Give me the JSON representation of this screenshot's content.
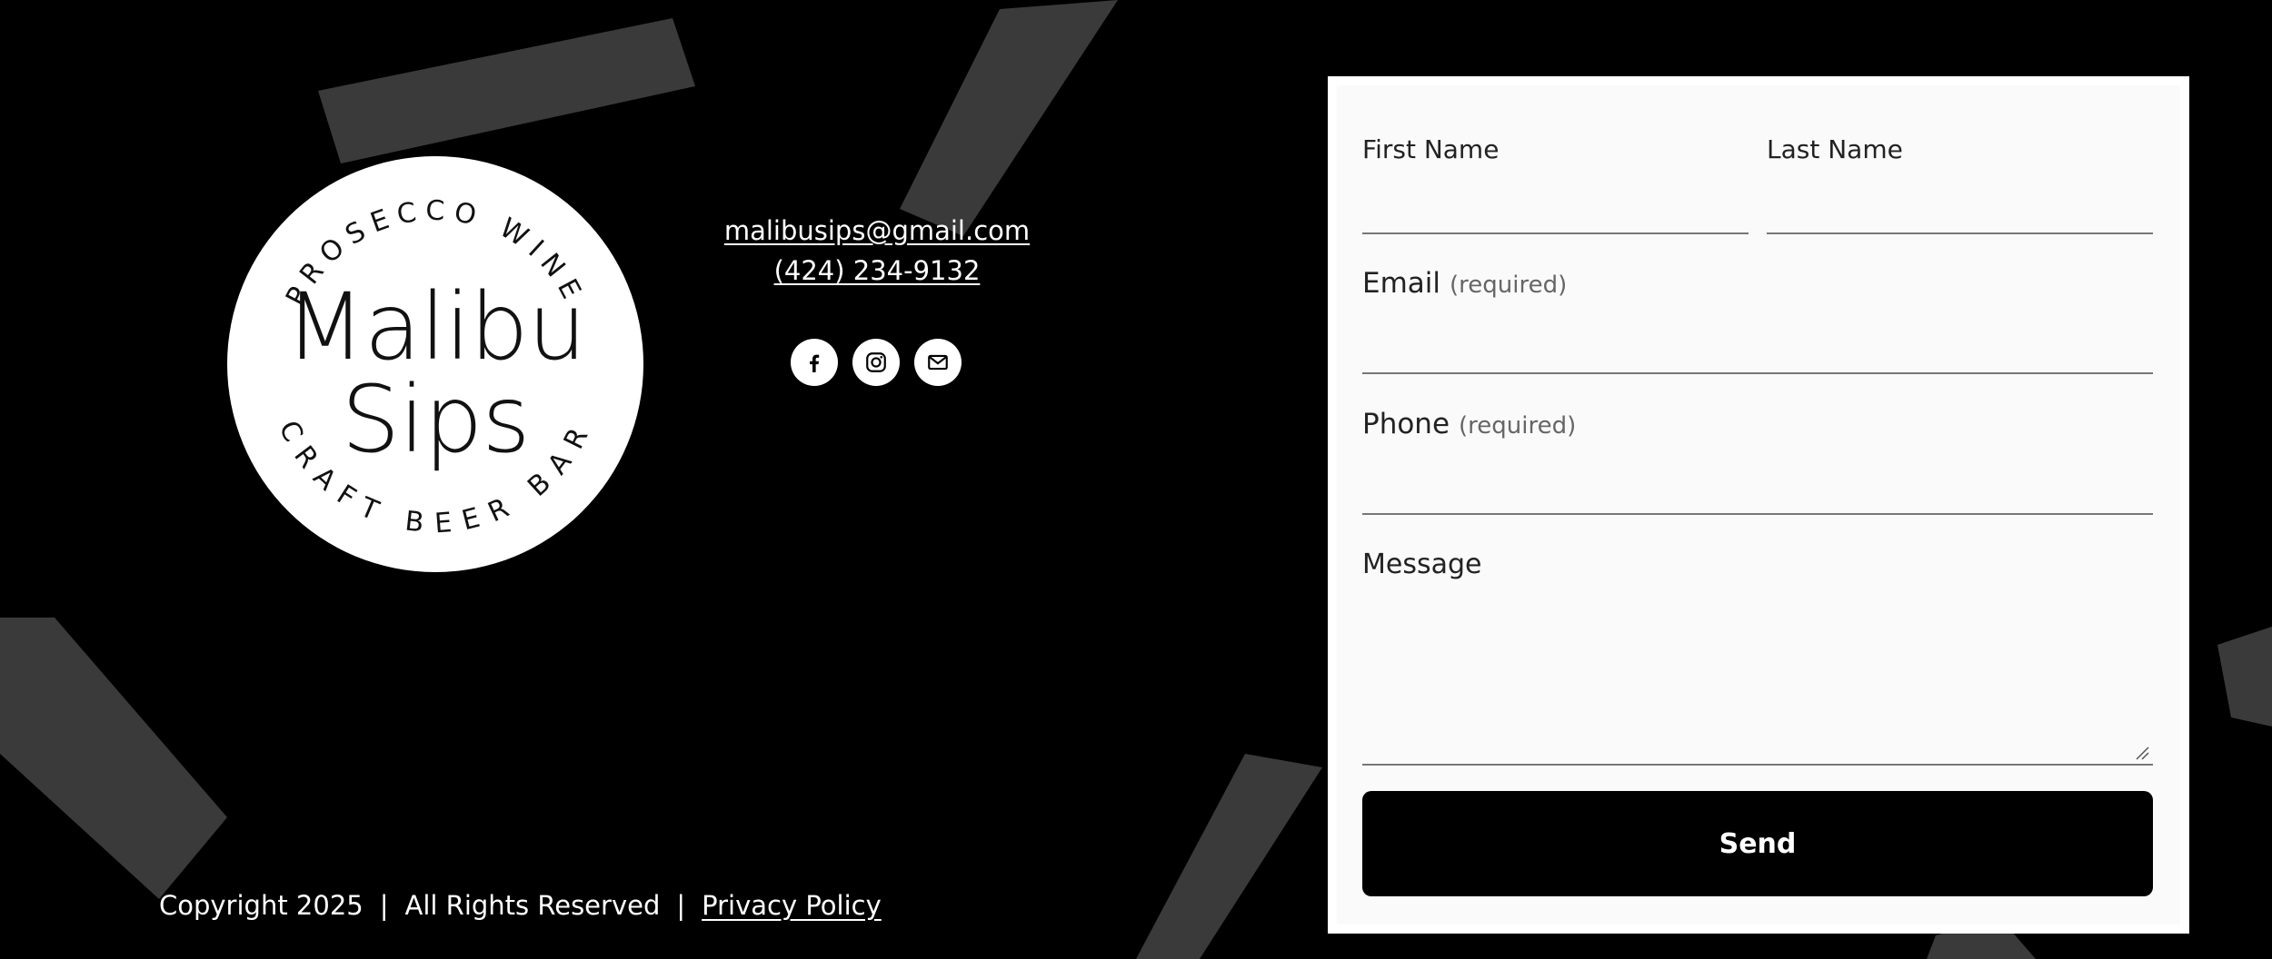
{
  "logo": {
    "top_arc": "PROSECCO WINE",
    "name_line1": "Malibu",
    "name_line2": "Sips",
    "bottom_arc": "CRAFT BEER BAR"
  },
  "contact": {
    "email": "malibusips@gmail.com",
    "phone": "(424) 234-9132"
  },
  "socials": [
    {
      "icon": "facebook-icon"
    },
    {
      "icon": "instagram-icon"
    },
    {
      "icon": "email-icon"
    }
  ],
  "footer": {
    "copyright": "Copyright 2025",
    "separator": "|",
    "rights": "All Rights Reserved",
    "privacy": "Privacy Policy"
  },
  "form": {
    "first_name": {
      "label": "First Name",
      "value": ""
    },
    "last_name": {
      "label": "Last Name",
      "value": ""
    },
    "email": {
      "label": "Email",
      "required": "(required)",
      "value": ""
    },
    "phone": {
      "label": "Phone",
      "required": "(required)",
      "value": ""
    },
    "message": {
      "label": "Message",
      "value": ""
    },
    "send_label": "Send"
  },
  "colors": {
    "background": "#000000",
    "brush": "#3a3a3a",
    "card": "#fafafa",
    "button": "#000000",
    "text_light": "#ffffff"
  }
}
